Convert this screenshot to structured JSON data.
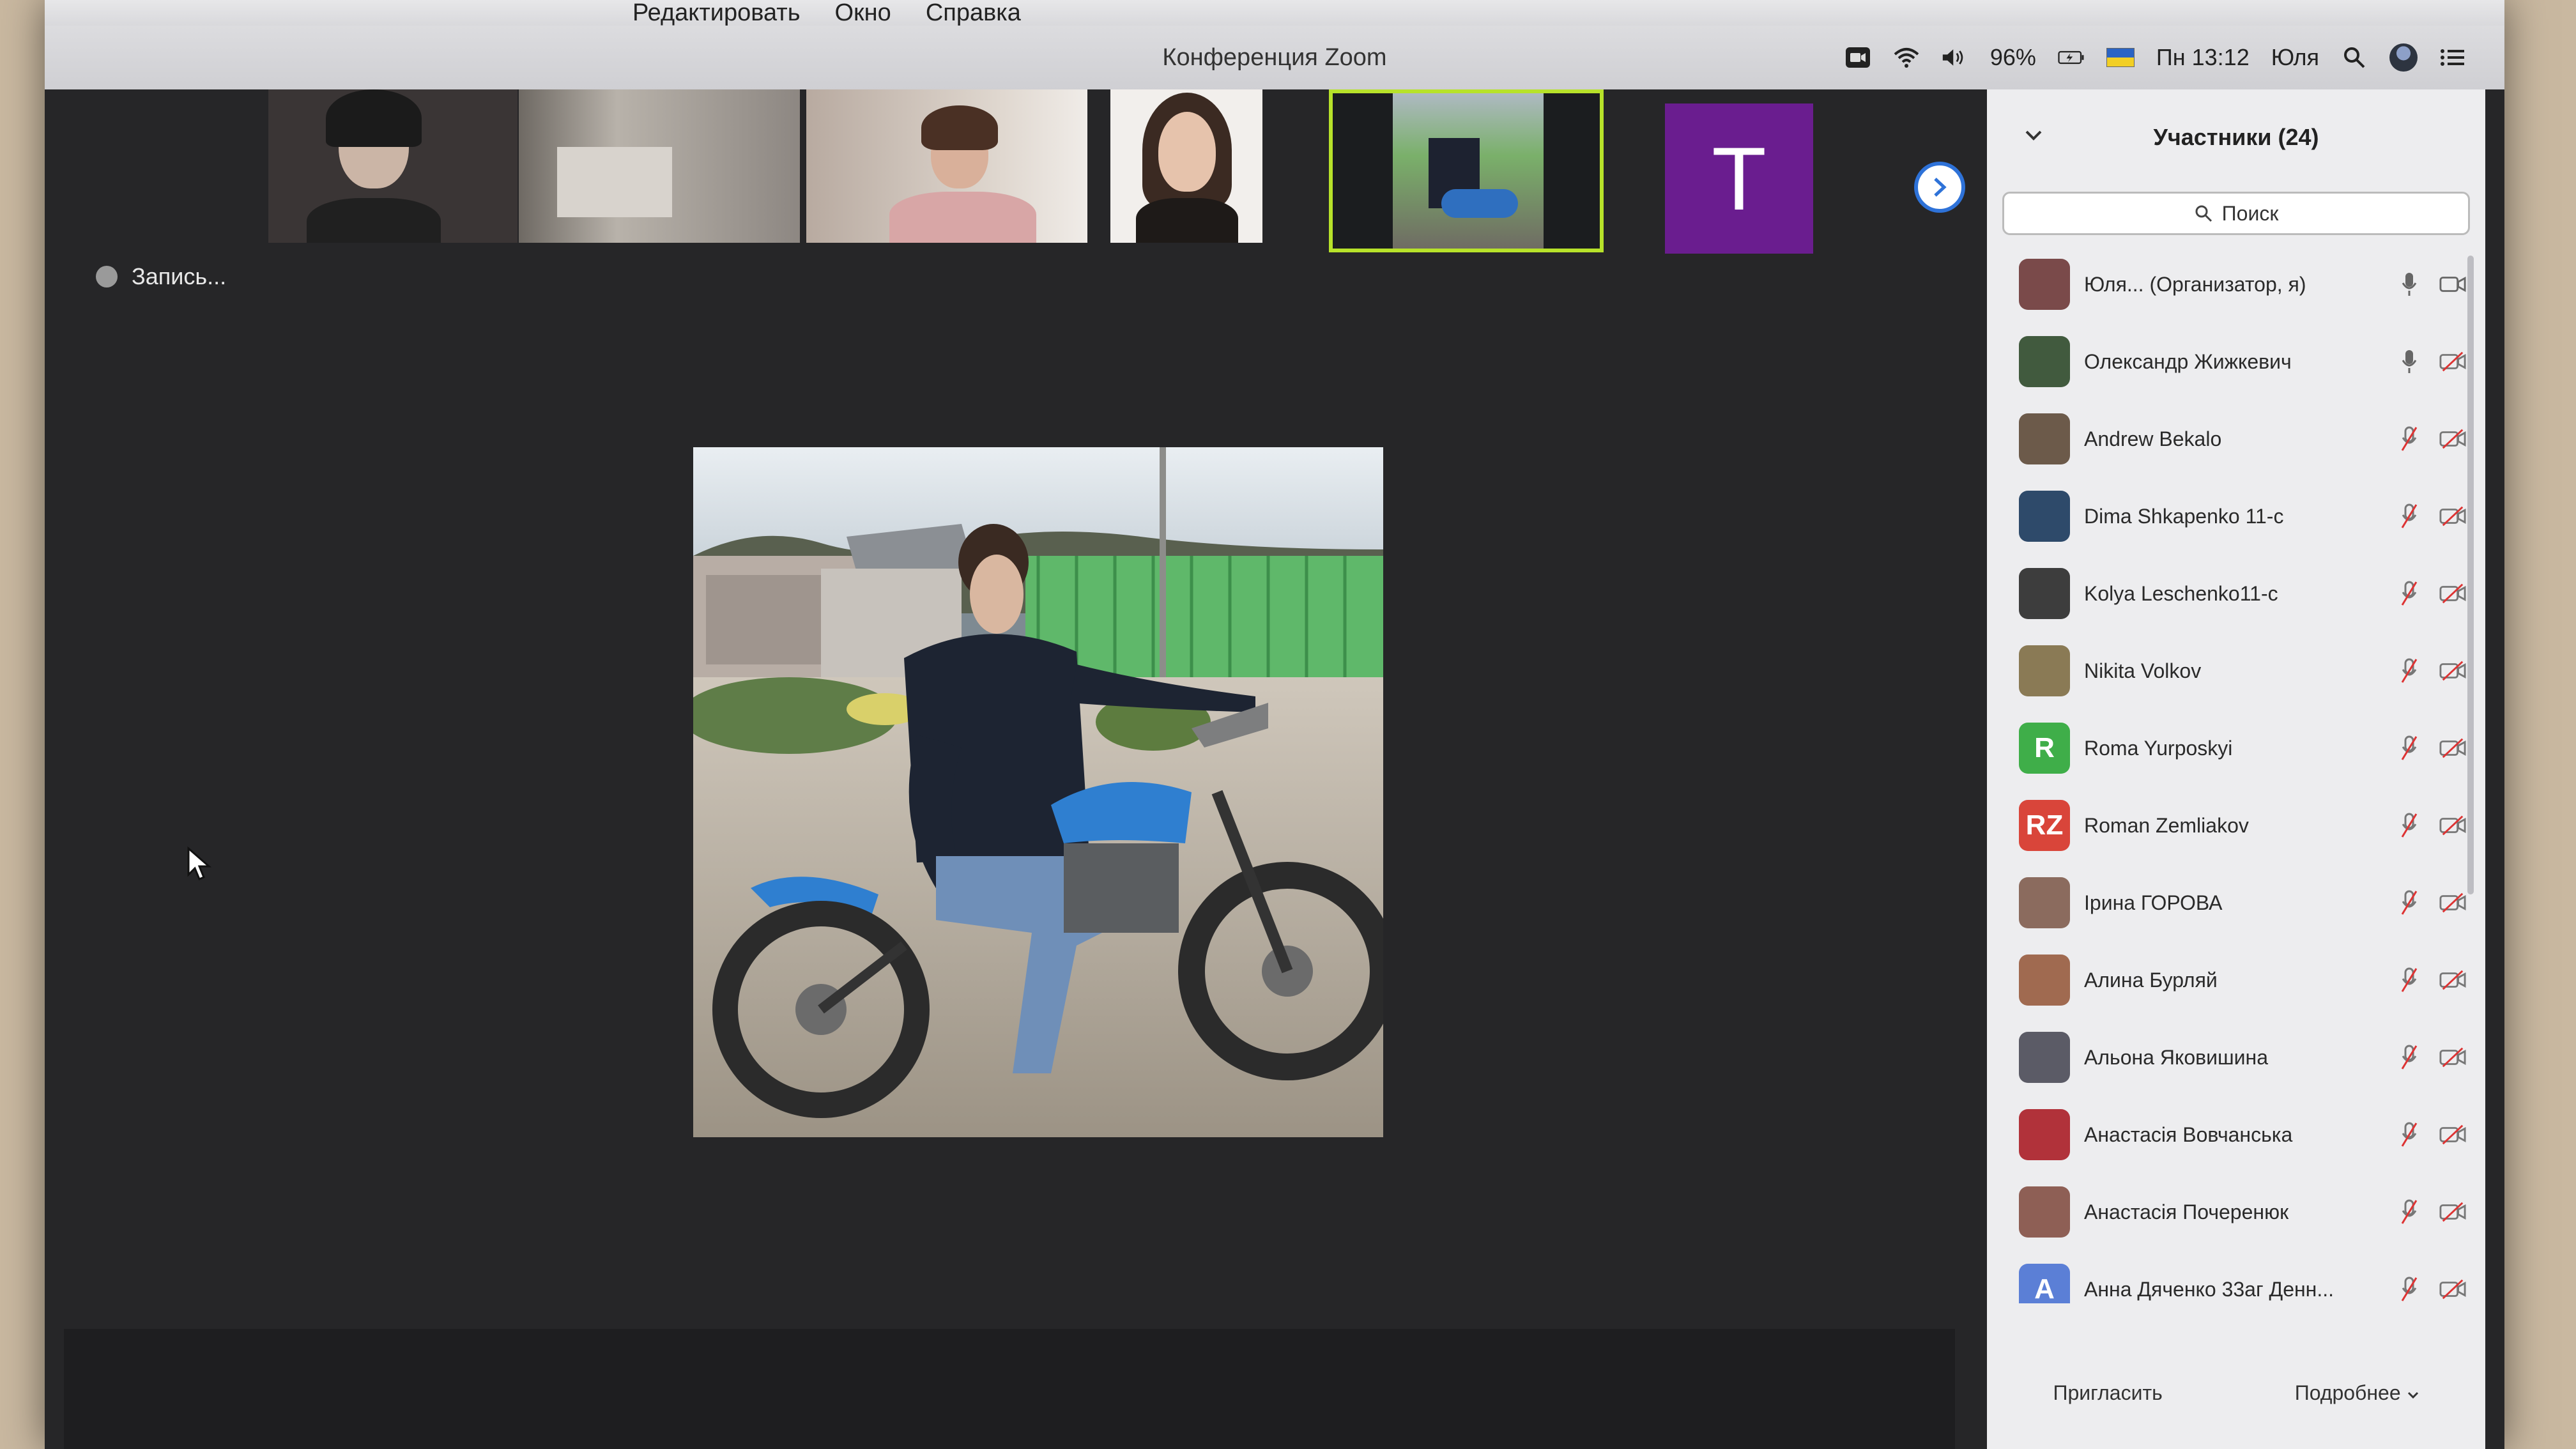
{
  "menubar": {
    "items": [
      "Редактировать",
      "Окно",
      "Справка"
    ],
    "battery": "96%",
    "clock": "Пн 13:12",
    "user": "Юля"
  },
  "window": {
    "title": "Конференция Zoom"
  },
  "strip": {
    "avatar_letter": "T",
    "next_icon": "chevron-right-icon"
  },
  "recording": {
    "label": "Запись..."
  },
  "panel": {
    "header": "Участники (24)",
    "search_placeholder": "Поиск",
    "participants": [
      {
        "name": "Юля...   (Организатор, я)",
        "initials": "",
        "color": "#7a4a4a",
        "mic": "on",
        "cam": "on"
      },
      {
        "name": "Олександр Жижкевич",
        "initials": "",
        "color": "#415a3e",
        "mic": "on",
        "cam": "off"
      },
      {
        "name": "Andrew Bekalo",
        "initials": "",
        "color": "#6c5a4a",
        "mic": "off",
        "cam": "off"
      },
      {
        "name": "Dima Shkapenko 11-c",
        "initials": "",
        "color": "#2e4a6a",
        "mic": "off",
        "cam": "off"
      },
      {
        "name": "Kolya Leschenko11-c",
        "initials": "",
        "color": "#3d3d3d",
        "mic": "off",
        "cam": "off"
      },
      {
        "name": "Nikita Volkov",
        "initials": "",
        "color": "#8a7a55",
        "mic": "off",
        "cam": "off"
      },
      {
        "name": "Roma Yurposkyi",
        "initials": "R",
        "color": "#3fae49",
        "mic": "off",
        "cam": "off"
      },
      {
        "name": "Roman Zemliakov",
        "initials": "RZ",
        "color": "#d9453a",
        "mic": "off",
        "cam": "off"
      },
      {
        "name": "Ірина ГОРОВА",
        "initials": "",
        "color": "#8b6b5e",
        "mic": "off",
        "cam": "off"
      },
      {
        "name": "Алина Бурляй",
        "initials": "",
        "color": "#a06a50",
        "mic": "off",
        "cam": "off"
      },
      {
        "name": "Альона Яковишина",
        "initials": "",
        "color": "#5b5b66",
        "mic": "off",
        "cam": "off"
      },
      {
        "name": "Анастасія Вовчанська",
        "initials": "",
        "color": "#b1323a",
        "mic": "off",
        "cam": "off"
      },
      {
        "name": "Анастасія Почеренюк",
        "initials": "",
        "color": "#8e5f55",
        "mic": "off",
        "cam": "off"
      },
      {
        "name": "Анна Дяченко 33аг Денн...",
        "initials": "A",
        "color": "#5b7fd6",
        "mic": "off",
        "cam": "off"
      }
    ],
    "invite_label": "Пригласить",
    "more_label": "Подробнее"
  }
}
